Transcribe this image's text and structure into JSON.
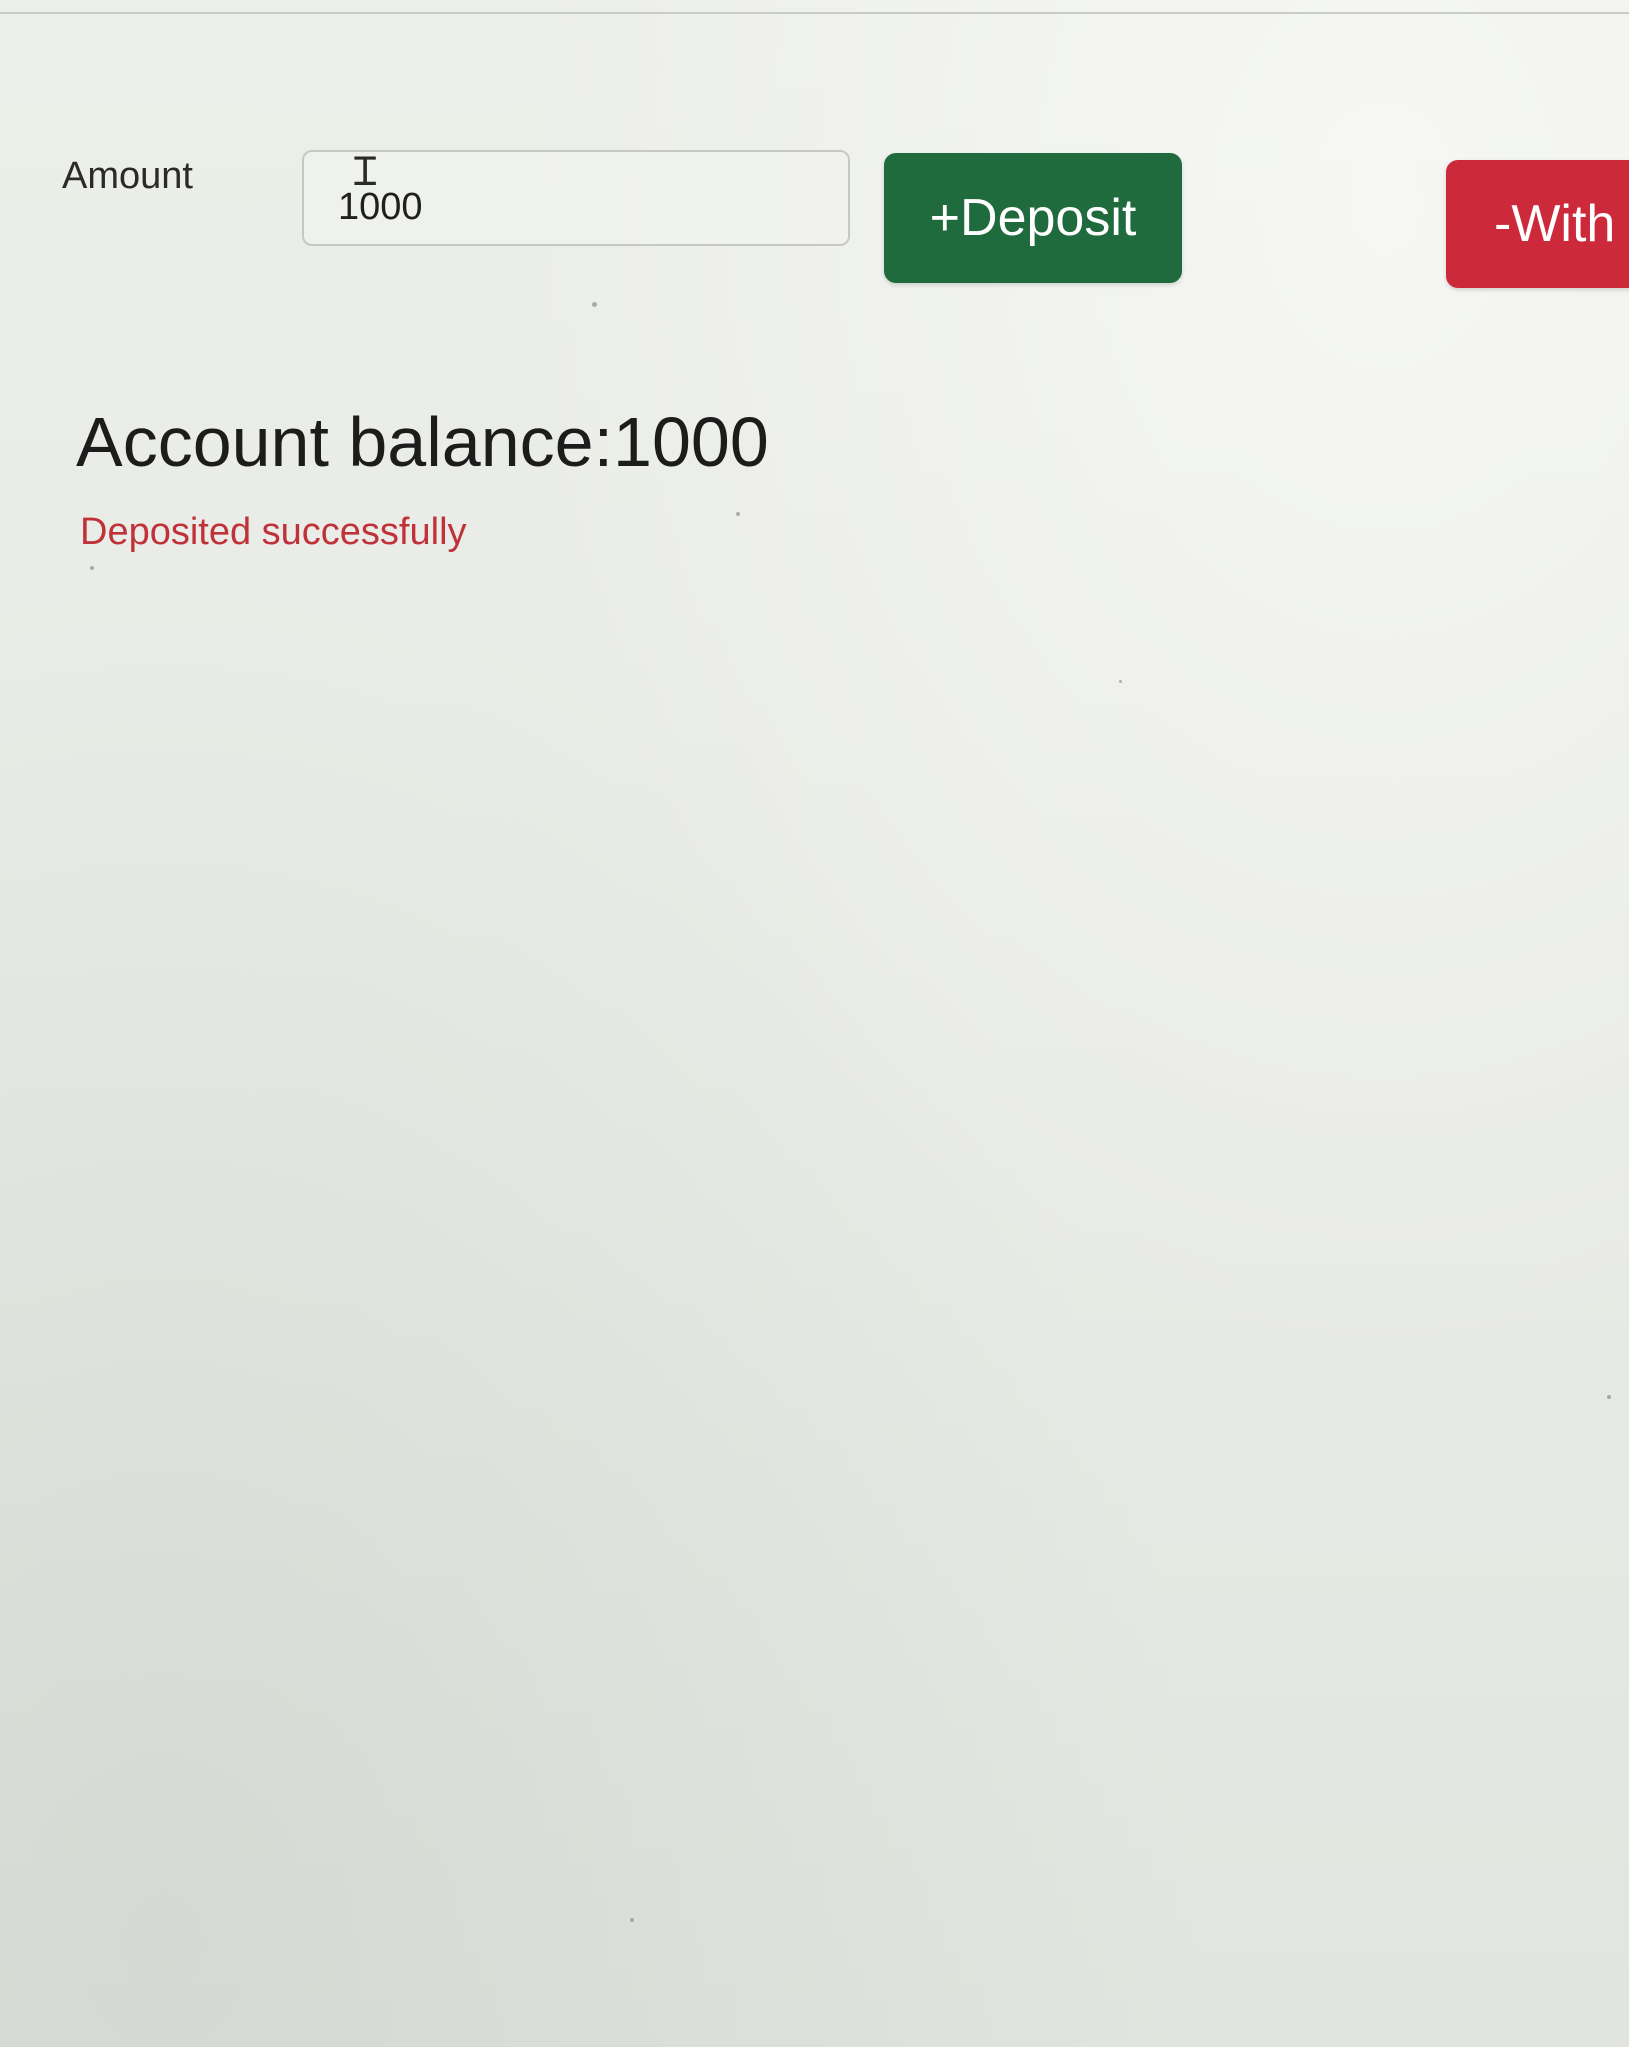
{
  "form": {
    "amount_label": "Amount",
    "amount_value": "1000",
    "deposit_label": "+Deposit",
    "withdraw_label": "-With"
  },
  "account": {
    "balance_label": "Account balance:",
    "balance_value": "1000"
  },
  "status": {
    "message": "Deposited successfully"
  },
  "colors": {
    "deposit_button": "#1f6b3d",
    "withdraw_button": "#cc2a3b",
    "status_text": "#c0323a"
  }
}
